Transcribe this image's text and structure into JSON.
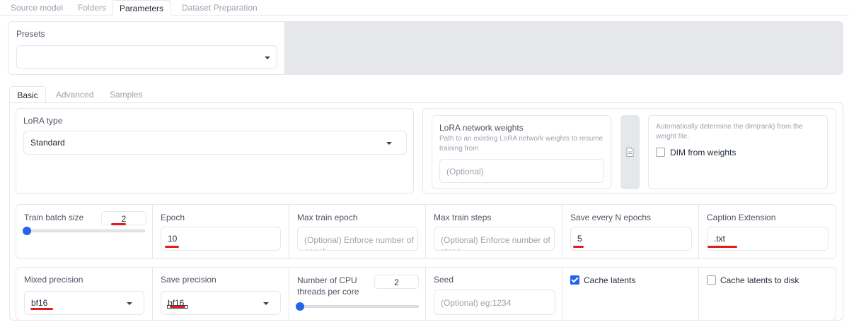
{
  "top_tabs": [
    "Source model",
    "Folders",
    "Parameters",
    "Dataset Preparation"
  ],
  "presets": {
    "label": "Presets",
    "value": ""
  },
  "sub_tabs": [
    "Basic",
    "Advanced",
    "Samples"
  ],
  "lora_type": {
    "label": "LoRA type",
    "value": "Standard"
  },
  "lora_weights": {
    "title": "LoRA network weights",
    "desc": "Path to an existing LoRA network weights to resume training from",
    "placeholder": "(Optional)"
  },
  "dim": {
    "desc": "Automatically determine the dim(rank) from the weight file.",
    "checkbox_label": "DIM from weights"
  },
  "row1": {
    "train_batch_size": {
      "label": "Train batch size",
      "value": "2",
      "slider_fraction": 0.0
    },
    "epoch": {
      "label": "Epoch",
      "value": "10"
    },
    "max_train_epoch": {
      "label": "Max train epoch",
      "placeholder": "(Optional) Enforce number of epoch"
    },
    "max_train_steps": {
      "label": "Max train steps",
      "placeholder": "(Optional) Enforce number of steps"
    },
    "save_every_n_epochs": {
      "label": "Save every N epochs",
      "value": "5"
    },
    "caption_extension": {
      "label": "Caption Extension",
      "value": ".txt"
    }
  },
  "row2": {
    "mixed_precision": {
      "label": "Mixed precision",
      "value": "bf16"
    },
    "save_precision": {
      "label": "Save precision",
      "value": "bf16"
    },
    "cpu_threads": {
      "label": "Number of CPU threads per core",
      "value": "2",
      "slider_fraction": 0.0
    },
    "seed": {
      "label": "Seed",
      "placeholder": "(Optional) eg:1234"
    },
    "cache_latents": {
      "label": "Cache latents",
      "checked": true
    },
    "cache_latents_disk": {
      "label": "Cache latents to disk",
      "checked": false
    }
  },
  "colors": {
    "accent": "#2563eb",
    "annotation": "#e11d1d",
    "gray_panel": "#e5e7eb"
  }
}
